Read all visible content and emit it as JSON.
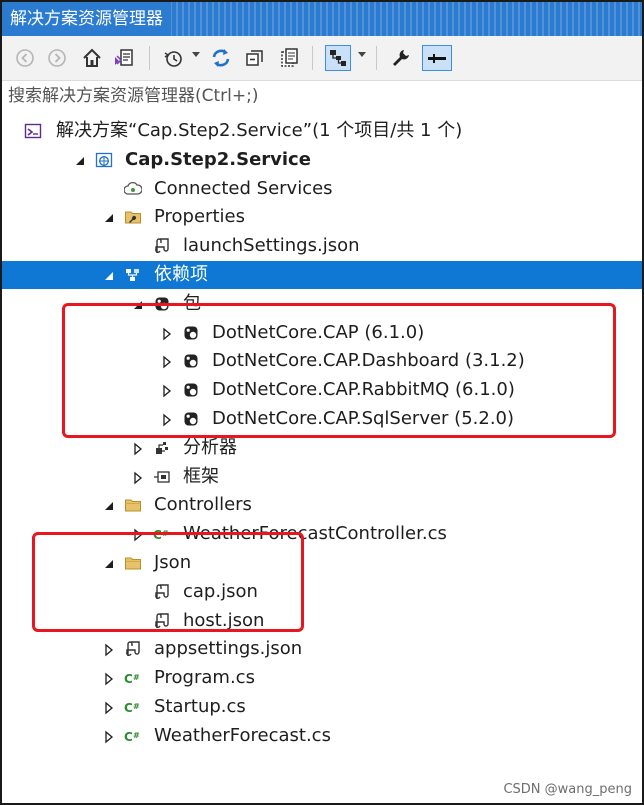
{
  "window": {
    "title": "解决方案资源管理器"
  },
  "toolbar": {
    "icons": [
      "back-icon",
      "forward-icon",
      "home-icon",
      "switch-view-icon",
      "history-icon",
      "sync-icon",
      "collapse-all-icon",
      "show-all-files-icon",
      "preview-icon",
      "properties-icon",
      "auto-hide-icon"
    ]
  },
  "search": {
    "placeholder": "搜索解决方案资源管理器(Ctrl+;)"
  },
  "tree": [
    {
      "label": "解决方案“Cap.Step2.Service”(1 个项目/共 1 个)",
      "icon": "solution-icon",
      "expander": "none",
      "indent": 0
    },
    {
      "label": "Cap.Step2.Service",
      "icon": "web-project-icon",
      "expander": "expanded",
      "indent": 1,
      "bold": true
    },
    {
      "label": "Connected Services",
      "icon": "connected-services-icon",
      "expander": "none",
      "indent": 2
    },
    {
      "label": "Properties",
      "icon": "properties-folder-icon",
      "expander": "expanded",
      "indent": 2
    },
    {
      "label": "launchSettings.json",
      "icon": "json-file-icon",
      "expander": "none",
      "indent": 3
    },
    {
      "label": "依赖项",
      "icon": "dependencies-icon",
      "expander": "expanded",
      "indent": 2,
      "selected": true
    },
    {
      "label": "包",
      "icon": "package-icon",
      "expander": "expanded",
      "indent": 3
    },
    {
      "label": "DotNetCore.CAP (6.1.0)",
      "icon": "package-icon",
      "expander": "collapsed",
      "indent": 4
    },
    {
      "label": "DotNetCore.CAP.Dashboard (3.1.2)",
      "icon": "package-icon",
      "expander": "collapsed",
      "indent": 4
    },
    {
      "label": "DotNetCore.CAP.RabbitMQ (6.1.0)",
      "icon": "package-icon",
      "expander": "collapsed",
      "indent": 4
    },
    {
      "label": "DotNetCore.CAP.SqlServer (5.2.0)",
      "icon": "package-icon",
      "expander": "collapsed",
      "indent": 4
    },
    {
      "label": "分析器",
      "icon": "analyzer-icon",
      "expander": "collapsed",
      "indent": 3
    },
    {
      "label": "框架",
      "icon": "framework-icon",
      "expander": "collapsed",
      "indent": 3
    },
    {
      "label": "Controllers",
      "icon": "folder-icon",
      "expander": "expanded",
      "indent": 2
    },
    {
      "label": "WeatherForecastController.cs",
      "icon": "csharp-file-icon",
      "expander": "collapsed",
      "indent": 3
    },
    {
      "label": "Json",
      "icon": "folder-icon",
      "expander": "expanded",
      "indent": 2
    },
    {
      "label": "cap.json",
      "icon": "json-file-icon",
      "expander": "none",
      "indent": 3
    },
    {
      "label": "host.json",
      "icon": "json-file-icon",
      "expander": "none",
      "indent": 3
    },
    {
      "label": "appsettings.json",
      "icon": "json-file-icon",
      "expander": "collapsed",
      "indent": 2
    },
    {
      "label": "Program.cs",
      "icon": "csharp-file-icon",
      "expander": "collapsed",
      "indent": 2
    },
    {
      "label": "Startup.cs",
      "icon": "csharp-file-icon",
      "expander": "collapsed",
      "indent": 2
    },
    {
      "label": "WeatherForecast.cs",
      "icon": "csharp-file-icon",
      "expander": "collapsed",
      "indent": 2
    }
  ],
  "watermark": "CSDN @wang_peng",
  "colors": {
    "title_bar": "#2b7bd1",
    "selection": "#0e78d4",
    "highlight_border": "#e8161f"
  }
}
